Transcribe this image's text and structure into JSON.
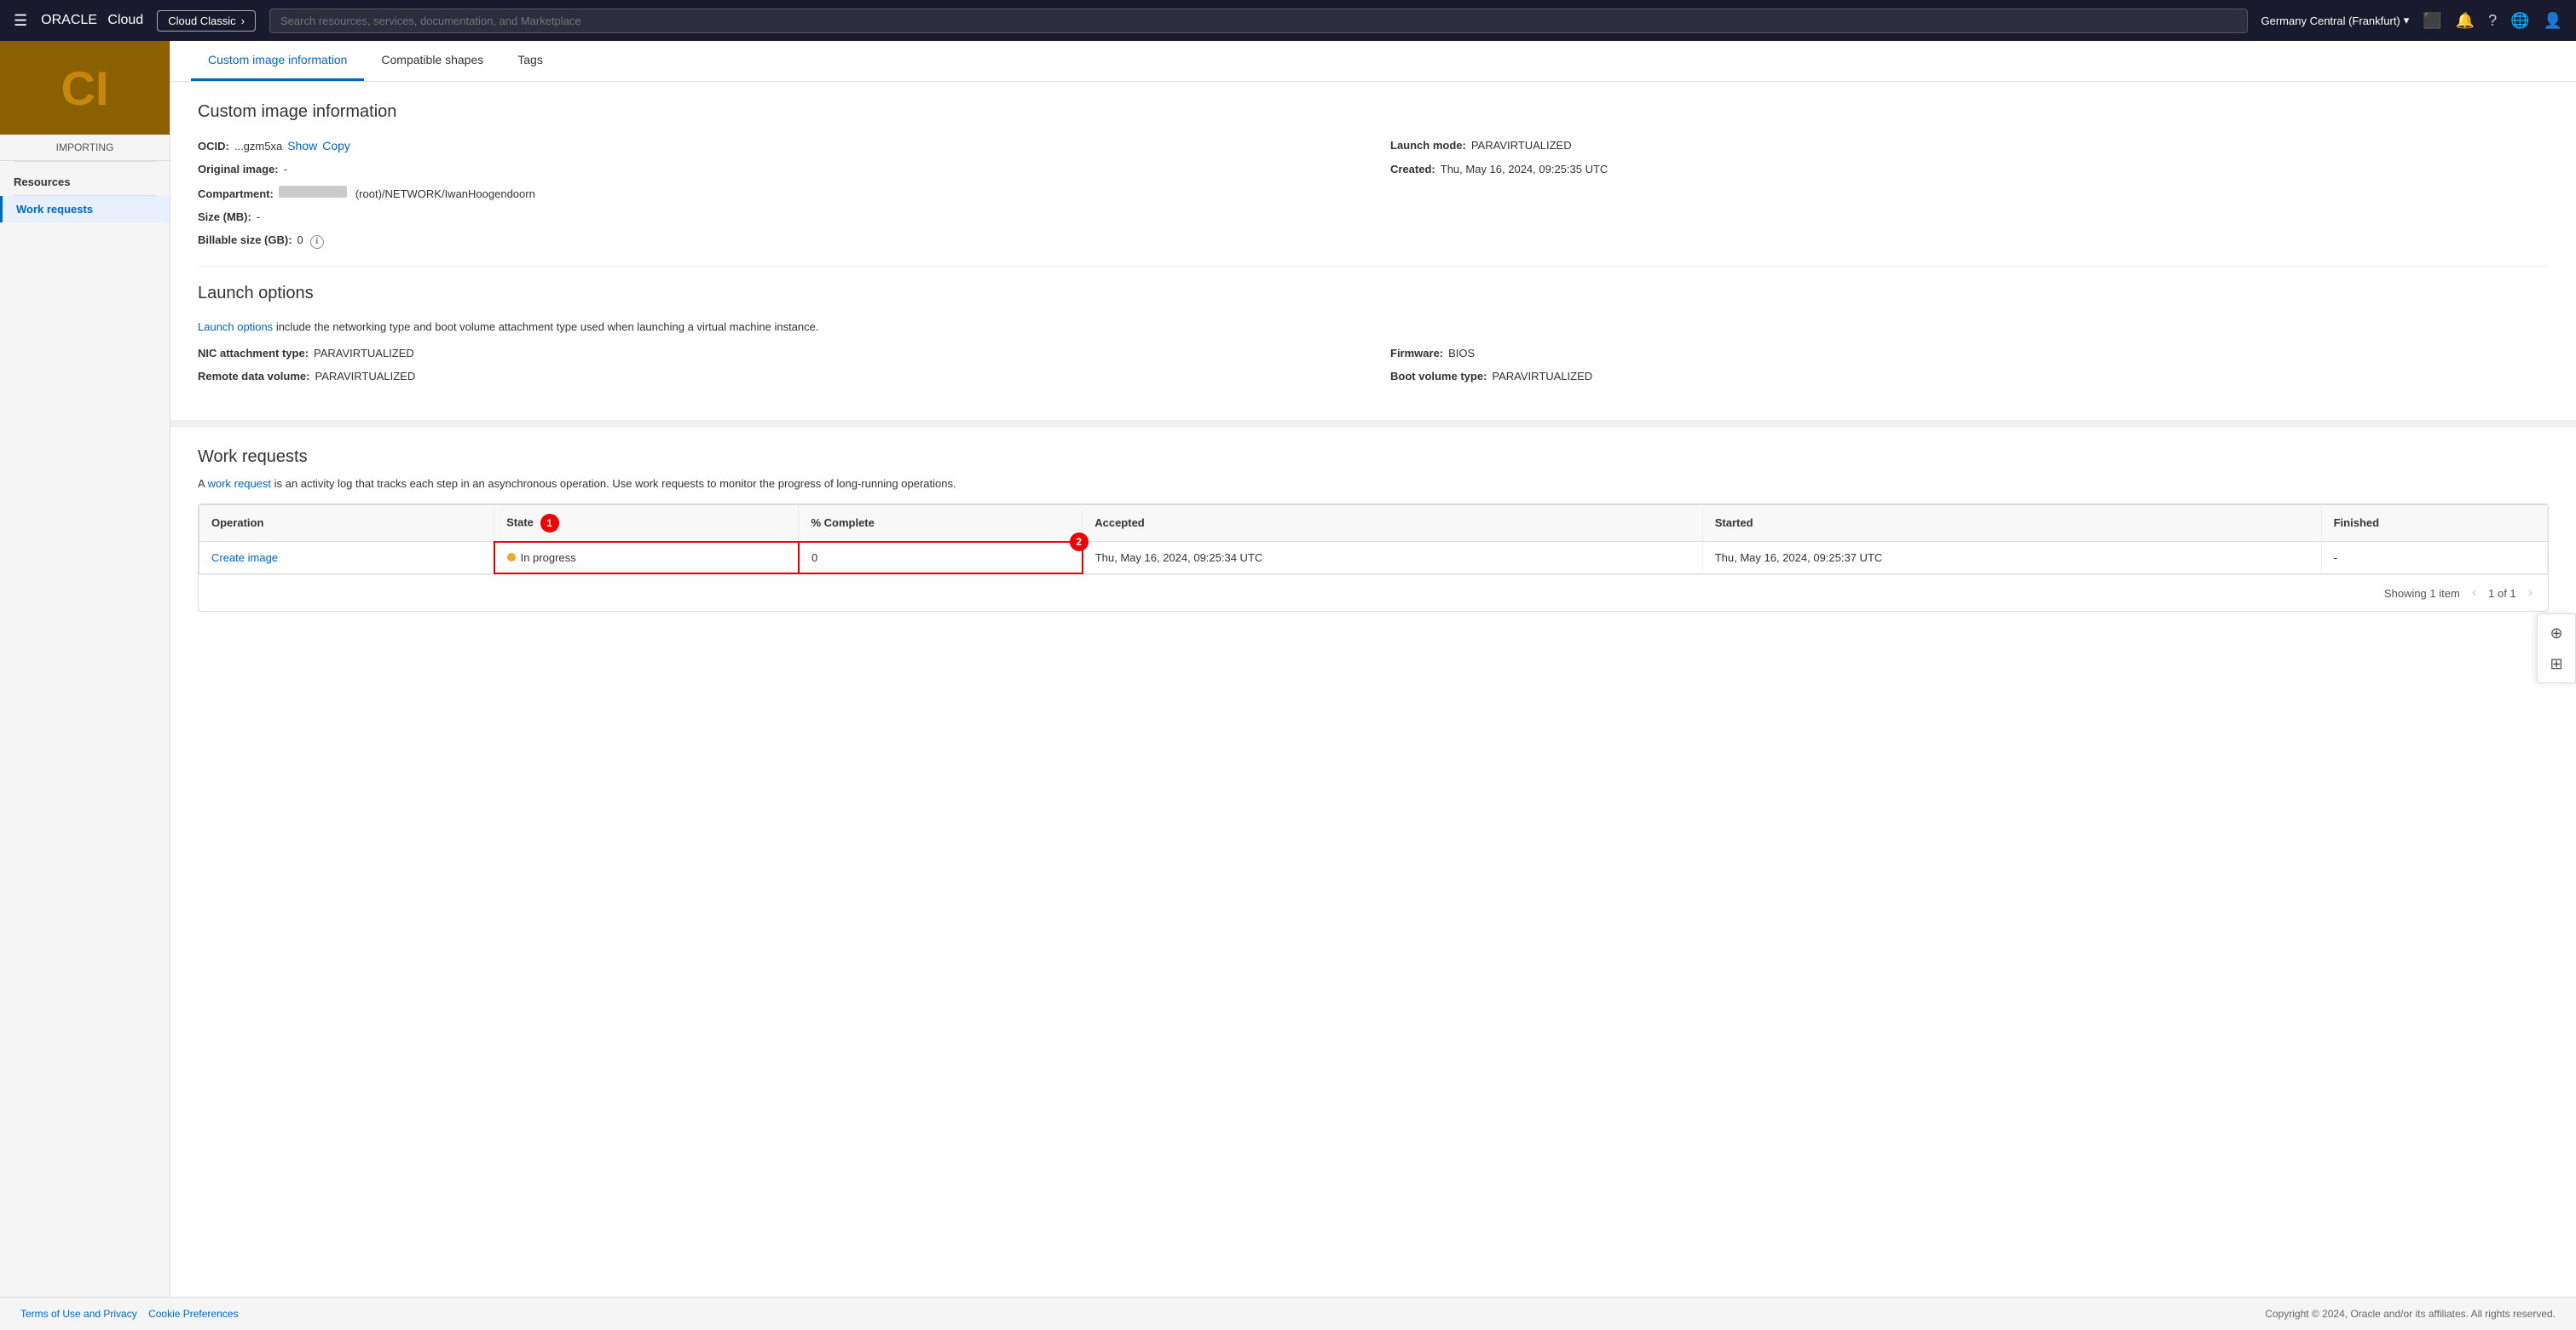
{
  "topnav": {
    "hamburger": "☰",
    "logo_oracle": "ORACLE",
    "logo_cloud": "Cloud",
    "classic_btn": "Cloud Classic",
    "classic_arrow": "›",
    "search_placeholder": "Search resources, services, documentation, and Marketplace",
    "region": "Germany Central (Frankfurt)",
    "region_arrow": "▾"
  },
  "sidebar": {
    "image_initials": "CI",
    "image_status": "IMPORTING",
    "resources_label": "Resources",
    "nav_items": [
      {
        "label": "Work requests",
        "active": true
      }
    ]
  },
  "tabs": [
    {
      "label": "Custom image information",
      "active": true
    },
    {
      "label": "Compatible shapes",
      "active": false
    },
    {
      "label": "Tags",
      "active": false
    }
  ],
  "custom_image_info": {
    "section_title": "Custom image information",
    "ocid_label": "OCID:",
    "ocid_value": "...gzm5xa",
    "ocid_show": "Show",
    "ocid_copy": "Copy",
    "launch_mode_label": "Launch mode:",
    "launch_mode_value": "PARAVIRTUALIZED",
    "original_image_label": "Original image:",
    "original_image_value": "-",
    "created_label": "Created:",
    "created_value": "Thu, May 16, 2024, 09:25:35 UTC",
    "compartment_label": "Compartment:",
    "compartment_blurred": "",
    "compartment_path": "(root)/NETWORK/IwanHoogendoorn",
    "size_label": "Size (MB):",
    "size_value": "-",
    "billable_size_label": "Billable size (GB):",
    "billable_size_value": "0",
    "billable_size_info": "ℹ"
  },
  "launch_options": {
    "section_title": "Launch options",
    "description_link": "Launch options",
    "description_text": "include the networking type and boot volume attachment type used when launching a virtual machine instance.",
    "nic_label": "NIC attachment type:",
    "nic_value": "PARAVIRTUALIZED",
    "firmware_label": "Firmware:",
    "firmware_value": "BIOS",
    "remote_data_label": "Remote data volume:",
    "remote_data_value": "PARAVIRTUALIZED",
    "boot_volume_label": "Boot volume type:",
    "boot_volume_value": "PARAVIRTUALIZED"
  },
  "work_requests": {
    "section_title": "Work requests",
    "description_prefix": "A",
    "description_link": "work request",
    "description_text": "is an activity log that tracks each step in an asynchronous operation. Use work requests to monitor the progress of long-running operations.",
    "table": {
      "columns": [
        "Operation",
        "State",
        "% Complete",
        "Accepted",
        "Started",
        "Finished"
      ],
      "rows": [
        {
          "operation": "Create image",
          "state": "In progress",
          "state_color": "#f5a623",
          "percent_complete": "0",
          "accepted": "Thu, May 16, 2024, 09:25:34 UTC",
          "started": "Thu, May 16, 2024, 09:25:37 UTC",
          "finished": "-"
        }
      ]
    },
    "pagination": {
      "showing": "Showing 1 item",
      "page_info": "1 of 1"
    },
    "annotation_1": "1",
    "annotation_2": "2"
  },
  "footer": {
    "left_links": [
      "Terms of Use and Privacy",
      "Cookie Preferences"
    ],
    "copyright": "Copyright © 2024, Oracle and/or its affiliates. All rights reserved."
  }
}
